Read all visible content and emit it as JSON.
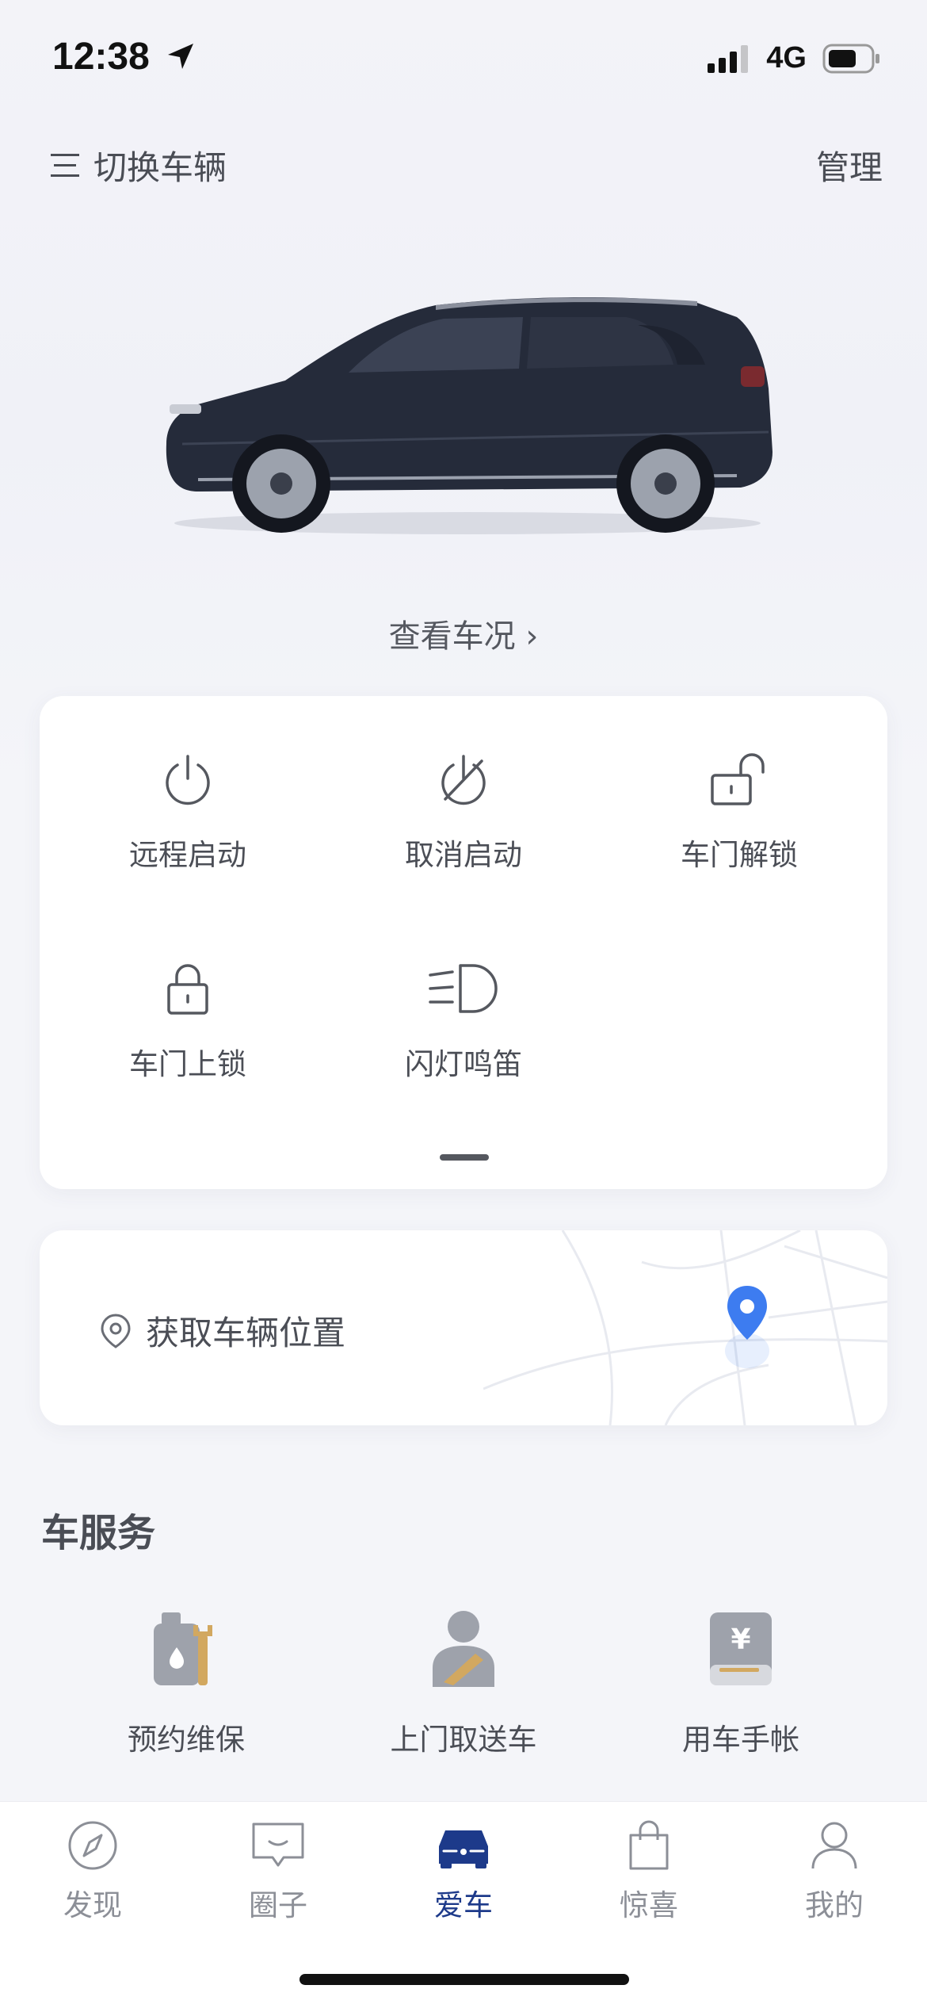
{
  "status_bar": {
    "time": "12:38",
    "network": "4G"
  },
  "header": {
    "switch_label": "切换车辆",
    "manage_label": "管理"
  },
  "vehicle": {
    "view_status_label": "查看车况 ›"
  },
  "controls": [
    {
      "label": "远程启动",
      "icon": "power-icon"
    },
    {
      "label": "取消启动",
      "icon": "power-off-icon"
    },
    {
      "label": "车门解锁",
      "icon": "unlock-icon"
    },
    {
      "label": "车门上锁",
      "icon": "lock-icon"
    },
    {
      "label": "闪灯鸣笛",
      "icon": "headlight-icon"
    }
  ],
  "location": {
    "label": "获取车辆位置"
  },
  "services": {
    "title": "车服务",
    "items": [
      {
        "label": "预约维保",
        "icon": "maintenance-icon"
      },
      {
        "label": "上门取送车",
        "icon": "pickup-driver-icon"
      },
      {
        "label": "用车手帐",
        "icon": "ledger-icon"
      }
    ]
  },
  "tabs": [
    {
      "label": "发现",
      "icon": "compass-icon"
    },
    {
      "label": "圈子",
      "icon": "chat-icon"
    },
    {
      "label": "爱车",
      "icon": "car-icon"
    },
    {
      "label": "惊喜",
      "icon": "bag-icon"
    },
    {
      "label": "我的",
      "icon": "person-icon"
    }
  ],
  "colors": {
    "accent": "#1d3a8a",
    "map_pin": "#3d7cf0"
  }
}
